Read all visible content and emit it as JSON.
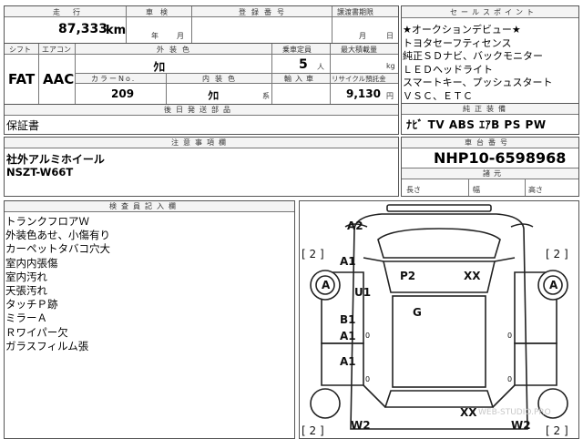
{
  "header": {
    "mileage_label": "走行",
    "inspection_label": "車検",
    "registration_label": "登録番号",
    "transfer_label": "譲渡書期限",
    "mileage": "87,333",
    "mileage_unit": "km",
    "year_unit": "年",
    "month_unit_1": "月",
    "month_unit_2": "月",
    "day_unit": "日"
  },
  "specs": {
    "shift_label": "シフト",
    "ac_label": "エアコン",
    "ext_color_label": "外装色",
    "capacity_label": "乗車定員",
    "max_load_label": "最大積載量",
    "shift": "FAT",
    "ac": "AAC",
    "ext_color": "ｸﾛ",
    "capacity": "5",
    "capacity_unit": "人",
    "load_unit": "kg",
    "color_no_label": "カラーNo.",
    "int_color_label": "内装色",
    "import_label": "輸入車",
    "recycle_label": "リサイクル預託金",
    "color_no": "209",
    "int_color": "ｸﾛ",
    "int_color_suffix": "系",
    "recycle": "9,130",
    "recycle_unit": "円"
  },
  "parts": {
    "label": "後日発送部品",
    "value": "保証書"
  },
  "sales_points": {
    "label": "セールスポイント",
    "lines": [
      "★オークションデビュー★",
      "トヨタセーフティセンス",
      "純正ＳＤナビ、バックモニター",
      "ＬＥＤヘッドライト",
      "スマートキー、プッシュスタート",
      "ＶＳＣ、ＥＴＣ"
    ]
  },
  "equipment": {
    "label": "純正装備",
    "value": "ﾅﾋﾞ TV ABS ｴｱB PS PW"
  },
  "notes": {
    "label": "注意事項欄",
    "lines": [
      "社外アルミホイール",
      "NSZT-W66T"
    ]
  },
  "chassis": {
    "label": "車台番号",
    "value": "NHP10-6598968",
    "dims_label": "諸元",
    "length_label": "長さ",
    "width_label": "幅",
    "height_label": "高さ"
  },
  "inspector": {
    "label": "検査員記入欄",
    "lines": [
      "トランクフロアＷ",
      "外装色あせ、小傷有り",
      "カーペットタバコ穴大",
      "室内内張傷",
      "室内汚れ",
      "天張汚れ",
      "タッチＰ跡",
      "ミラーＡ",
      "Ｒワイパー欠",
      "ガラスフィルム張"
    ]
  },
  "diagram": {
    "marks": {
      "a2": "A2",
      "front_right_bracket": "[ 2 ]",
      "front_left_bracket": "[ 2 ]",
      "front_left_fender": "A1",
      "front_left_door_upper": "U1",
      "left_wheel_front": "A",
      "right_wheel_front": "A",
      "roof_front": "P2",
      "roof_right": "XX",
      "center": "G",
      "left_door_b": "B1",
      "left_door_a": "A1",
      "left_door_zero": "0",
      "left_rear_a": "A1",
      "left_rear_zero": "0",
      "right_door_zero_1": "0",
      "right_door_zero_2": "0",
      "rear_xx": "XX",
      "rear_left_bracket": "[ 2 ]",
      "rear_right_bracket": "[ 2 ]",
      "rear_left_w": "W2",
      "rear_right_w": "W2"
    },
    "watermark": "WEB-STUDIO.PRO"
  }
}
